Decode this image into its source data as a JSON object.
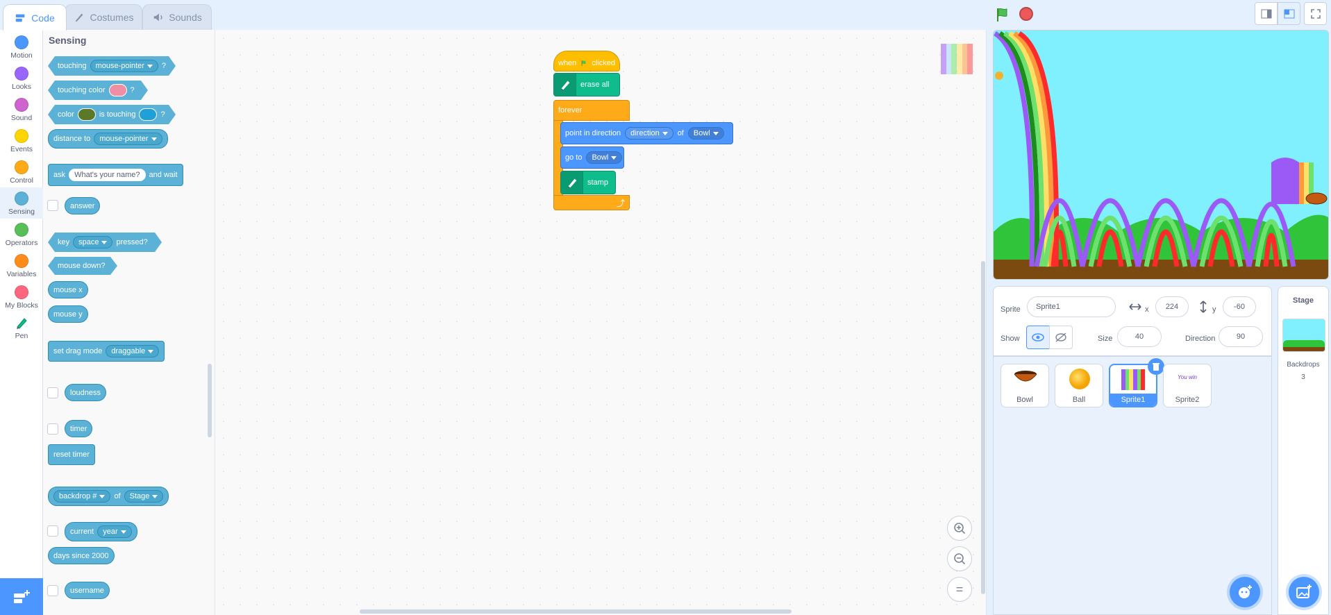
{
  "tabs": [
    {
      "label": "Code"
    },
    {
      "label": "Costumes"
    },
    {
      "label": "Sounds"
    }
  ],
  "categories": [
    {
      "label": "Motion",
      "color": "#4c97ff"
    },
    {
      "label": "Looks",
      "color": "#9966ff"
    },
    {
      "label": "Sound",
      "color": "#cf63cf"
    },
    {
      "label": "Events",
      "color": "#ffd500"
    },
    {
      "label": "Control",
      "color": "#ffab19"
    },
    {
      "label": "Sensing",
      "color": "#5cb1d6"
    },
    {
      "label": "Operators",
      "color": "#59c059"
    },
    {
      "label": "Variables",
      "color": "#ff8c1a"
    },
    {
      "label": "My Blocks",
      "color": "#ff6680"
    },
    {
      "label": "Pen",
      "color": "#0fbd8c"
    }
  ],
  "flyout": {
    "heading": "Sensing",
    "touching": {
      "label": "touching",
      "value": "mouse-pointer",
      "q": "?"
    },
    "touching_color": {
      "label": "touching color",
      "q": "?",
      "color": "#ef8ea4"
    },
    "color_touching": {
      "label": "color",
      "mid": "is touching",
      "q": "?",
      "color1": "#5a7a2a",
      "color2": "#1ea0d8"
    },
    "distance": {
      "label": "distance to",
      "value": "mouse-pointer"
    },
    "ask": {
      "label": "ask",
      "value": "What's your name?",
      "tail": "and wait"
    },
    "answer": "answer",
    "key": {
      "label": "key",
      "value": "space",
      "tail": "pressed?"
    },
    "mouse_down": "mouse down?",
    "mouse_x": "mouse x",
    "mouse_y": "mouse y",
    "drag": {
      "label": "set drag mode",
      "value": "draggable"
    },
    "loudness": "loudness",
    "timer": "timer",
    "reset_timer": "reset timer",
    "backdrop": {
      "value": "backdrop #",
      "of": "of",
      "target": "Stage"
    },
    "current": {
      "label": "current",
      "value": "year"
    },
    "days": "days since 2000",
    "username": "username"
  },
  "script": {
    "hat": {
      "when": "when",
      "clicked": "clicked"
    },
    "erase": "erase all",
    "forever": "forever",
    "point": {
      "label": "point in direction",
      "prop": "direction",
      "of": "of",
      "target": "Bowl"
    },
    "goto": {
      "label": "go to",
      "target": "Bowl"
    },
    "stamp": "stamp"
  },
  "sprite_info": {
    "sprite_label": "Sprite",
    "sprite_name": "Sprite1",
    "x_label": "x",
    "x": "224",
    "y_label": "y",
    "y": "-60",
    "show_label": "Show",
    "size_label": "Size",
    "size": "40",
    "direction_label": "Direction",
    "direction": "90"
  },
  "sprites": [
    {
      "name": "Bowl"
    },
    {
      "name": "Ball"
    },
    {
      "name": "Sprite1"
    },
    {
      "name": "Sprite2",
      "thumb_text": "You win"
    }
  ],
  "stage_pane": {
    "title": "Stage",
    "backdrops_label": "Backdrops",
    "backdrops_count": "3"
  },
  "zoom": {
    "reset": "="
  }
}
